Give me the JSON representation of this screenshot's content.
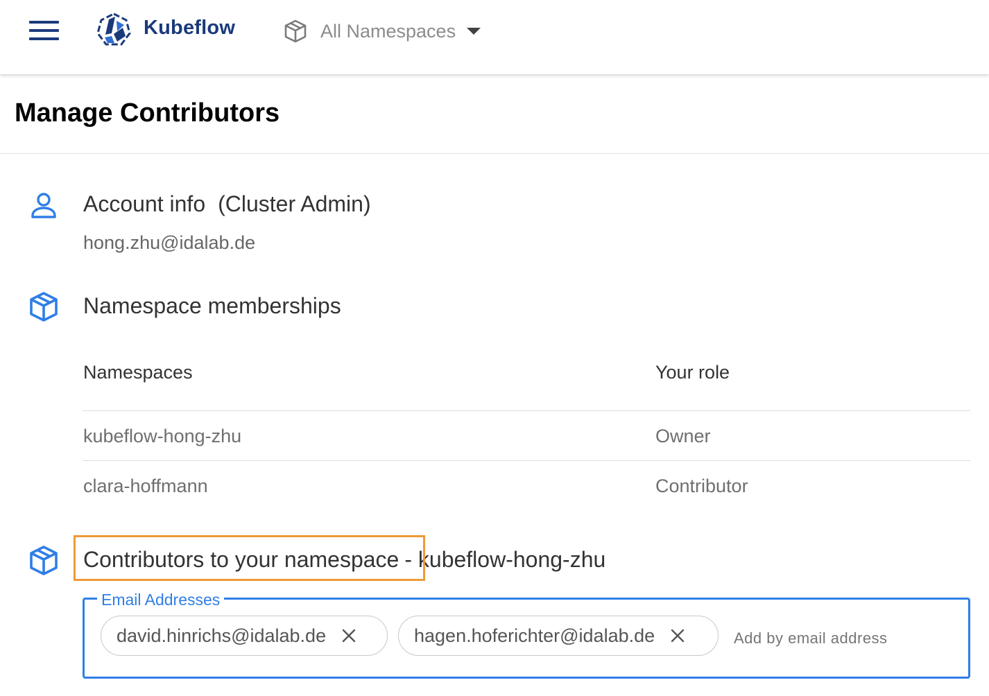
{
  "header": {
    "brand": "Kubeflow",
    "namespace_selector": {
      "label": "All Namespaces"
    }
  },
  "page": {
    "title": "Manage Contributors"
  },
  "account": {
    "title": "Account info",
    "role_badge": "(Cluster Admin)",
    "email": "hong.zhu@idalab.de"
  },
  "memberships": {
    "title": "Namespace memberships",
    "columns": [
      "Namespaces",
      "Your role"
    ],
    "rows": [
      {
        "namespace": "kubeflow-hong-zhu",
        "role": "Owner"
      },
      {
        "namespace": "clara-hoffmann",
        "role": "Contributor"
      }
    ]
  },
  "contributors": {
    "title": "Contributors to your namespace",
    "namespace_suffix": "- kubeflow-hong-zhu",
    "field_label": "Email Addresses",
    "chips": [
      "david.hinrichs@idalab.de",
      "hagen.hoferichter@idalab.de"
    ],
    "input_placeholder": "Add by email address"
  },
  "colors": {
    "brand": "#1a3a7a",
    "accent_blue": "#2f7ee6",
    "highlight_orange": "#ee9a39"
  },
  "icons": {
    "menu": "hamburger-menu-icon",
    "logo": "kubeflow-logo",
    "namespace": "cube-icon",
    "dropdown": "caret-down-icon",
    "account": "person-icon",
    "memberships": "cube-icon",
    "contributors": "cube-icon",
    "chip_remove": "close-icon"
  }
}
